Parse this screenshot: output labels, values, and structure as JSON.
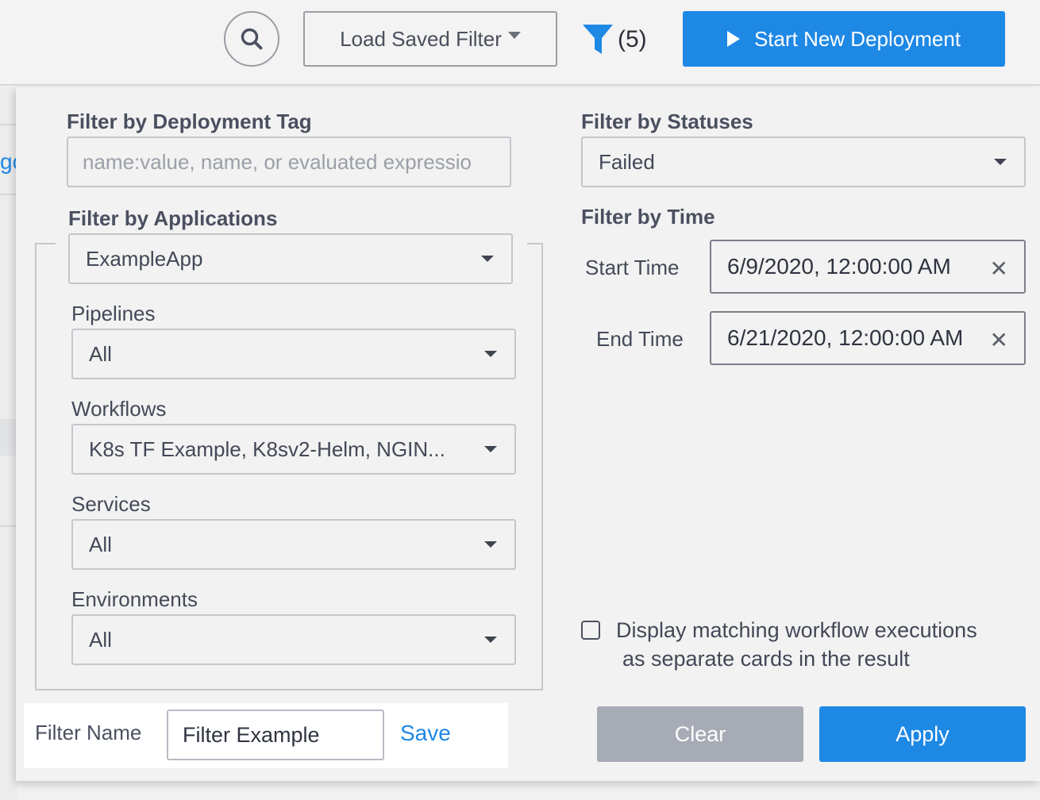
{
  "header": {
    "load_filter_label": "Load Saved Filter",
    "filter_count": "(5)",
    "start_label": "Start New Deployment"
  },
  "filters": {
    "tag_label": "Filter by Deployment Tag",
    "tag_placeholder": "name:value, name, or evaluated expressio",
    "applications_label": "Filter by Applications",
    "applications_value": "ExampleApp",
    "pipelines_label": "Pipelines",
    "pipelines_value": "All",
    "workflows_label": "Workflows",
    "workflows_value": "K8s TF Example, K8sv2-Helm, NGIN...",
    "services_label": "Services",
    "services_value": "All",
    "environments_label": "Environments",
    "environments_value": "All",
    "statuses_label": "Filter by Statuses",
    "statuses_value": "Failed",
    "time_label": "Filter by Time",
    "start_time_label": "Start Time",
    "start_time_value": "6/9/2020, 12:00:00 AM",
    "end_time_label": "End Time",
    "end_time_value": "6/21/2020, 12:00:00 AM",
    "separate_cards_line1": "Display matching workflow executions",
    "separate_cards_line2": "as separate cards in the result",
    "separate_cards_checked": false
  },
  "footer": {
    "filter_name_label": "Filter Name",
    "filter_name_value": "Filter Example",
    "save_label": "Save",
    "clear_label": "Clear",
    "apply_label": "Apply"
  },
  "colors": {
    "accent": "#1e88e5",
    "clear_button": "#a7abb5"
  },
  "icons": {
    "search": "search-icon",
    "filter": "filter-icon",
    "play": "play-icon",
    "dropdown": "chevron-down-icon",
    "clear": "close-icon"
  }
}
